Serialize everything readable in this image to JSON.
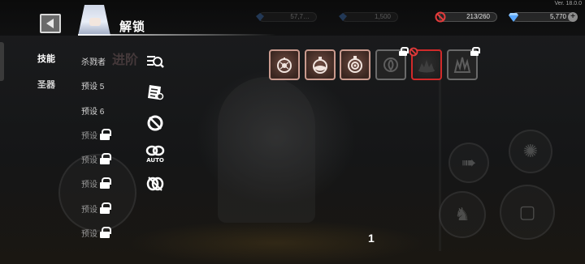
{
  "header": {
    "title": "解锁",
    "version": "Ver. 18.0.0"
  },
  "resources": [
    {
      "name": "ghost-resource-1",
      "value": "57,7…",
      "icon": "gem-icon",
      "dim": true
    },
    {
      "name": "ghost-resource-2",
      "value": "1,500",
      "icon": "gem-icon",
      "dim": true
    },
    {
      "name": "stamina",
      "value": "213/260",
      "icon": "ban-icon",
      "color": "#e23b3b"
    },
    {
      "name": "diamonds",
      "value": "5,770",
      "icon": "diamond-icon",
      "color": "#5aa8ff"
    }
  ],
  "tabs": [
    {
      "label": "技能",
      "active": true
    },
    {
      "label": "圣器",
      "active": false
    }
  ],
  "presets": [
    {
      "label": "杀戮者",
      "locked": false,
      "icon": "search-filter-icon"
    },
    {
      "label": "预设 5",
      "locked": false,
      "icon": "scroll-icon"
    },
    {
      "label": "预设 6",
      "locked": false,
      "icon": "ring-icon"
    },
    {
      "label": "预设",
      "locked": true,
      "icon": "auto-icon"
    },
    {
      "label": "预设",
      "locked": true,
      "icon": "link-icon"
    },
    {
      "label": "预设",
      "locked": true
    },
    {
      "label": "预设",
      "locked": true
    },
    {
      "label": "预设",
      "locked": true
    }
  ],
  "auto_badge": "AUTO",
  "skill_slots": [
    {
      "icon": "gear-orb-icon",
      "state": "active"
    },
    {
      "icon": "potion-icon",
      "state": "active"
    },
    {
      "icon": "eye-orb-icon",
      "state": "active"
    },
    {
      "icon": "swirl-icon",
      "state": "locked"
    },
    {
      "icon": "crown-flame-icon",
      "state": "disabled"
    },
    {
      "icon": "spikes-icon",
      "state": "locked"
    }
  ],
  "page_number": "1",
  "background_text": "进阶",
  "colors": {
    "slot_border": "#c99a8e",
    "disabled_border": "#d12a2a",
    "accent_red": "#e23b3b",
    "accent_blue": "#5aa8ff"
  }
}
